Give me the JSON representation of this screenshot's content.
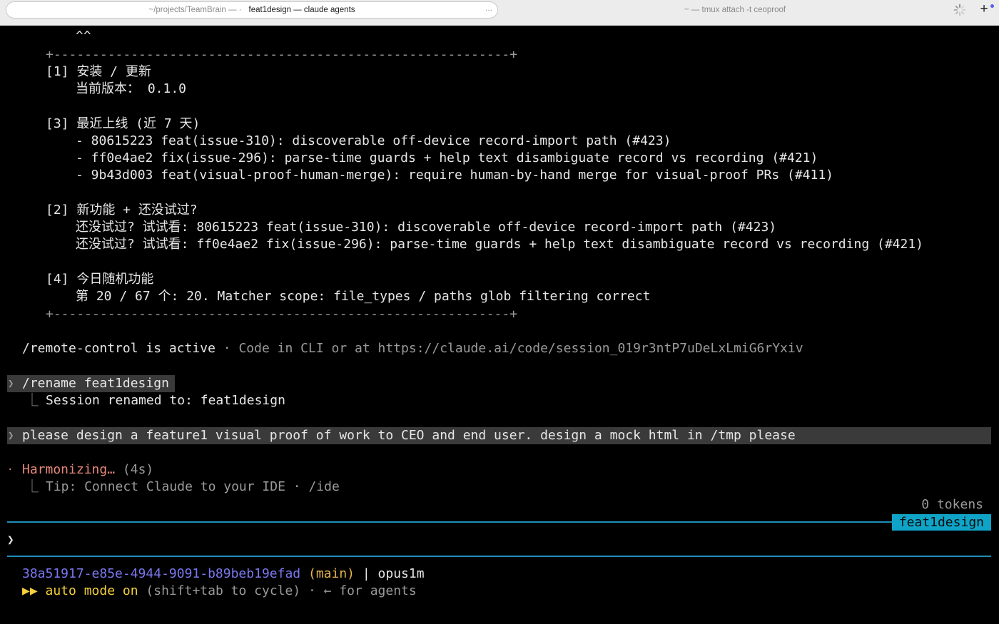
{
  "tabs": {
    "active_path": "~/projects/TeamBrain — ·",
    "active_title": "feat1design — claude agents",
    "overflow": "...",
    "inactive_title": "~ — tmux attach -t ceoproof",
    "new_tab": "+"
  },
  "term": {
    "caret_line": "^^",
    "border": "+-----------------------------------------------------------+",
    "s1": {
      "header": "[1] 安装 / 更新",
      "line": "当前版本： 0.1.0"
    },
    "s3": {
      "header": "[3] 最近上线 (近 7 天)",
      "items": [
        "- 80615223 feat(issue-310): discoverable off-device record-import path (#423)",
        "- ff0e4ae2 fix(issue-296): parse-time guards + help text disambiguate record vs recording (#421)",
        "- 9b43d003 feat(visual-proof-human-merge): require human-by-hand merge for visual-proof PRs (#411)"
      ]
    },
    "s2": {
      "header": "[2] 新功能 + 还没试过?",
      "items": [
        "还没试过? 试试看: 80615223 feat(issue-310): discoverable off-device record-import path (#423)",
        "还没试过? 试试看: ff0e4ae2 fix(issue-296): parse-time guards + help text disambiguate record vs recording (#421)"
      ]
    },
    "s4": {
      "header": "[4] 今日随机功能",
      "line": "第 20 / 67 个: 20. Matcher scope: file_types / paths glob filtering correct"
    },
    "remote": {
      "cmd": "/remote-control is active",
      "sep": " · ",
      "rest": "Code in CLI or at https://claude.ai/code/session_019r3ntP7uDeLxLmiG6rYxiv"
    },
    "rename": {
      "prompt": "❯",
      "cmd": "/rename feat1design",
      "tree": "⎿",
      "result": "Session renamed to: feat1design"
    },
    "user_msg": {
      "prompt": "❯",
      "text": "please design a feature1 visual proof of work to CEO and end user. design a mock html in /tmp please"
    },
    "status": {
      "bullet": "·",
      "label": "Harmonizing…",
      "time": "(4s)",
      "tree": "⎿",
      "tip": "Tip: Connect Claude to your IDE · /ide"
    },
    "tokens": "0 tokens",
    "session_badge": "feat1design",
    "input_prompt": "❯",
    "footer": {
      "session_id": "38a51917-e85e-4944-9091-b89beb19efad",
      "branch": "(main)",
      "sep": "|",
      "model": "opus1m",
      "auto_icon": "▶▶",
      "auto_label": "auto mode on",
      "auto_hint": "(shift+tab to cycle) · ← for agents"
    }
  },
  "colors": {
    "accent_cyan": "#0fa4c7",
    "rule": "#1f8fb8",
    "coral": "#e8877a",
    "purple": "#7b78f0",
    "gold": "#e8b64a"
  }
}
